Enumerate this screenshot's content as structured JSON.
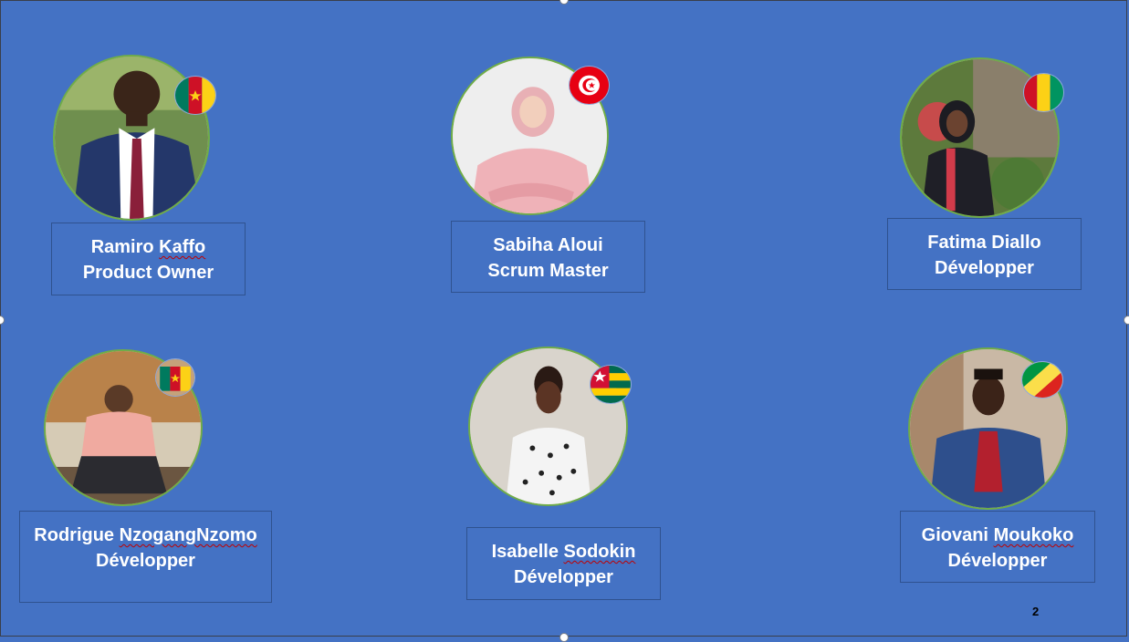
{
  "slide": {
    "page_number": "2",
    "background_color": "#4472c4",
    "members": [
      {
        "first_name": "Ramiro",
        "last_name": "Kaffo",
        "role": "Product Owner",
        "flag": "cameroon-flag"
      },
      {
        "first_name": "Sabiha",
        "last_name": "Aloui",
        "role": "Scrum Master",
        "flag": "tunisia-flag"
      },
      {
        "first_name": "Fatima",
        "last_name": "Diallo",
        "role": "Développer",
        "flag": "guinea-flag"
      },
      {
        "first_name": "Rodrigue",
        "last_name": "NzogangNzomo",
        "role": "Développer",
        "flag": "cameroon-flag"
      },
      {
        "first_name": "Isabelle",
        "last_name": "Sodokin",
        "role": "Développer",
        "flag": "togo-flag"
      },
      {
        "first_name": "Giovani",
        "last_name": "Moukoko",
        "role": "Développer",
        "flag": "congo-flag"
      }
    ]
  }
}
